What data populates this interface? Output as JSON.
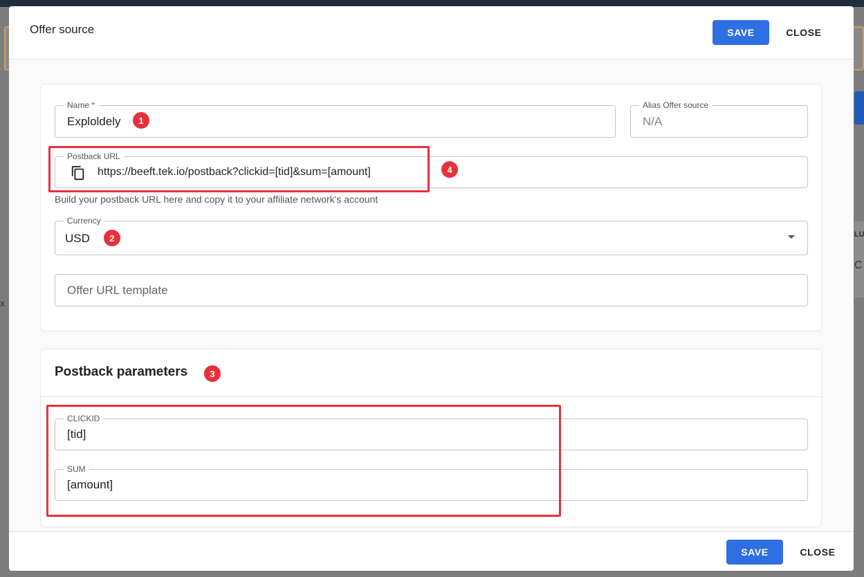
{
  "modal": {
    "title": "Offer source",
    "save_label": "SAVE",
    "close_label": "CLOSE"
  },
  "form": {
    "name": {
      "label": "Name *",
      "value": "Exploldely"
    },
    "alias": {
      "label": "Alias Offer source",
      "value": "N/A"
    },
    "postback_url": {
      "label": "Postback URL",
      "value": "https://beeft.tek.io/postback?clickid=[tid]&sum=[amount]",
      "helper": "Build your postback URL here and copy it to your affiliate network's account"
    },
    "currency": {
      "label": "Currency",
      "value": "USD"
    },
    "offer_url_template": {
      "placeholder": "Offer URL template"
    }
  },
  "postback_parameters": {
    "title": "Postback parameters",
    "clickid": {
      "label": "CLICKID",
      "value": "[tid]"
    },
    "sum": {
      "label": "SUM",
      "value": "[amount]"
    }
  },
  "annotations": {
    "badge1": "1",
    "badge2": "2",
    "badge3": "3",
    "badge4": "4"
  },
  "background": {
    "glyph_x": "x",
    "glyph_c": "C",
    "glyph_lu": "LU"
  },
  "colors": {
    "accent": "#2f6fe4",
    "annotation": "#e8303a"
  },
  "icons": {
    "copy": "copy-icon",
    "dropdown": "caret-down-icon"
  }
}
